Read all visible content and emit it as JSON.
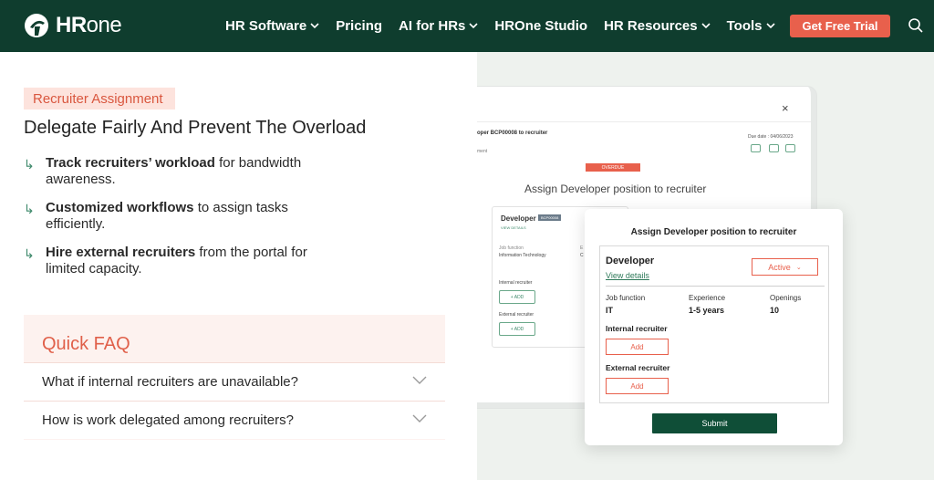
{
  "nav": {
    "logo_bold": "HR",
    "logo_light": "one",
    "items": [
      {
        "label": "HR Software",
        "dropdown": true
      },
      {
        "label": "Pricing",
        "dropdown": false
      },
      {
        "label": "AI for HRs",
        "dropdown": true
      },
      {
        "label": "HROne Studio",
        "dropdown": false
      },
      {
        "label": "HR Resources",
        "dropdown": true
      },
      {
        "label": "Tools",
        "dropdown": true
      }
    ],
    "cta": "Get Free Trial",
    "search_icon": "search-icon"
  },
  "feature": {
    "tag": "Recruiter Assignment",
    "heading": "Delegate Fairly And Prevent The Overload",
    "bullets": [
      {
        "bold": "Track recruiters’ workload",
        "rest": " for bandwidth awareness."
      },
      {
        "bold": "Customized workflows",
        "rest": " to assign tasks efficiently."
      },
      {
        "bold": "Hire external recruiters",
        "rest": " from the portal for limited capacity."
      }
    ]
  },
  "faq": {
    "title": "Quick FAQ",
    "questions": [
      "What if internal recruiters are unavailable?",
      "How is work delegated among recruiters?"
    ]
  },
  "preview_back": {
    "close": "×",
    "title": "oper BCP00008 to recruiter",
    "subtitle": "ment",
    "due": "Due date : 04/06/2023",
    "overdue": "OVERDUE",
    "assign_title": "Assign Developer position to recruiter",
    "card_title": "Developer",
    "card_badge": "BCP00008",
    "view_details": "VIEW DETAILS",
    "job_function_label": "Job function",
    "job_function_value": "Information Technology",
    "trailing_letter": "E",
    "trailing_letter_2": "C",
    "internal": "Internal recruiter",
    "external": "External recruiter",
    "add": "+ ADD"
  },
  "modal": {
    "title": "Assign Developer position to recruiter",
    "position": "Developer",
    "view_details": "View details",
    "status": "Active",
    "fields": [
      {
        "label": "Job function",
        "value": "IT"
      },
      {
        "label": "Experience",
        "value": "1-5 years"
      },
      {
        "label": "Openings",
        "value": "10"
      }
    ],
    "internal_label": "Internal recruiter",
    "external_label": "External recruiter",
    "add_label": "Add",
    "submit": "Submit"
  },
  "colors": {
    "nav_bg": "#0f3d2e",
    "accent": "#e8604c",
    "green": "#3f8a6c"
  }
}
